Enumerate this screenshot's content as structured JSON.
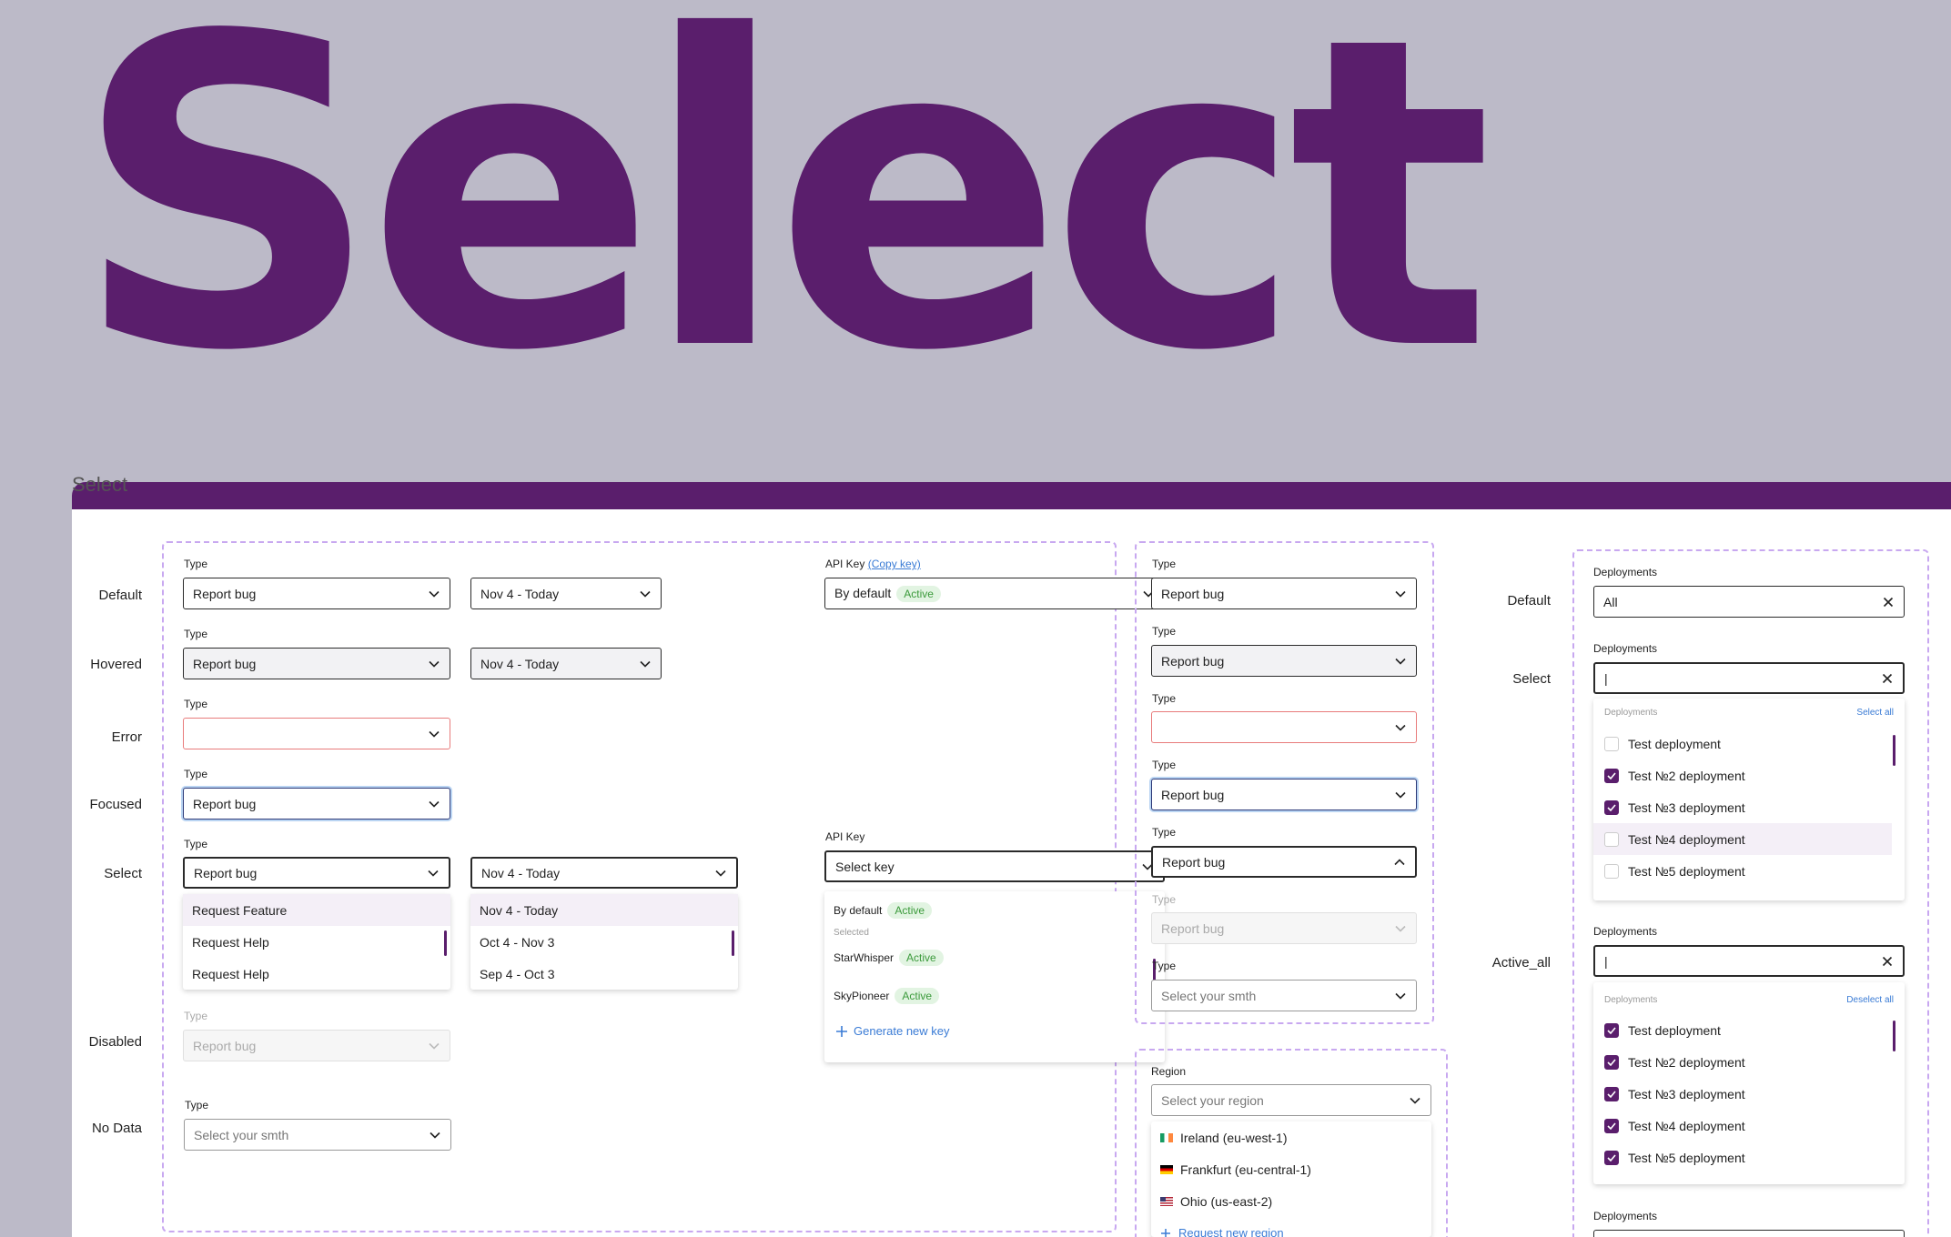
{
  "hero": {
    "title": "Select"
  },
  "section": {
    "label": "Select"
  },
  "colors": {
    "brand": "#5a1e6c",
    "frame": "#c8a8f0",
    "badge_bg": "#e2f4e2",
    "badge_fg": "#3b9a3b",
    "link": "#3a7bd5",
    "error": "#e87b7b"
  },
  "row_labels": {
    "default": "Default",
    "hovered": "Hovered",
    "error": "Error",
    "focused": "Focused",
    "select": "Select",
    "disabled": "Disabled",
    "no_data": "No Data"
  },
  "field_label": "Type",
  "values": {
    "report_bug": "Report bug",
    "date_range": "Nov 4 - Today",
    "placeholder": "Select your smth"
  },
  "api": {
    "label": "API Key",
    "copy_link": "(Copy key)",
    "default_value": "By default",
    "badge": "Active",
    "select_placeholder": "Select key",
    "selected_caption": "Selected",
    "keys": [
      {
        "name": "By default",
        "badge": "Active"
      },
      {
        "name": "StarWhisper",
        "badge": "Active"
      },
      {
        "name": "SkyPioneer",
        "badge": "Active"
      }
    ],
    "generate": "Generate new key"
  },
  "type_options": [
    "Request Feature",
    "Request Help",
    "Request Help"
  ],
  "date_options": [
    "Nov 4 - Today",
    "Oct 4 - Nov 3",
    "Sep 4 - Oct 3"
  ],
  "region": {
    "label": "Region",
    "placeholder": "Select your region",
    "options": [
      {
        "name": "Ireland (eu-west-1)",
        "flag": "ireland-flag-icon"
      },
      {
        "name": "Frankfurt (eu-central-1)",
        "flag": "germany-flag-icon"
      },
      {
        "name": "Ohio (us-east-2)",
        "flag": "usa-flag-icon"
      }
    ],
    "more": "Request new region"
  },
  "deployments": {
    "label": "Deployments",
    "row_labels": {
      "default": "Default",
      "select": "Select",
      "active_all": "Active_all"
    },
    "default_value": "All",
    "cursor": "|",
    "header": "Deployments",
    "select_all": "Select all",
    "deselect_all": "Deselect all",
    "select_list": [
      {
        "name": "Test deployment",
        "checked": false
      },
      {
        "name": "Test №2 deployment",
        "checked": true
      },
      {
        "name": "Test №3 deployment",
        "checked": true
      },
      {
        "name": "Test №4 deployment",
        "checked": false
      },
      {
        "name": "Test №5 deployment",
        "checked": false
      }
    ],
    "active_list": [
      {
        "name": "Test deployment",
        "checked": true
      },
      {
        "name": "Test №2 deployment",
        "checked": true
      },
      {
        "name": "Test №3 deployment",
        "checked": true
      },
      {
        "name": "Test №4 deployment",
        "checked": true
      },
      {
        "name": "Test №5 deployment",
        "checked": true
      }
    ]
  }
}
